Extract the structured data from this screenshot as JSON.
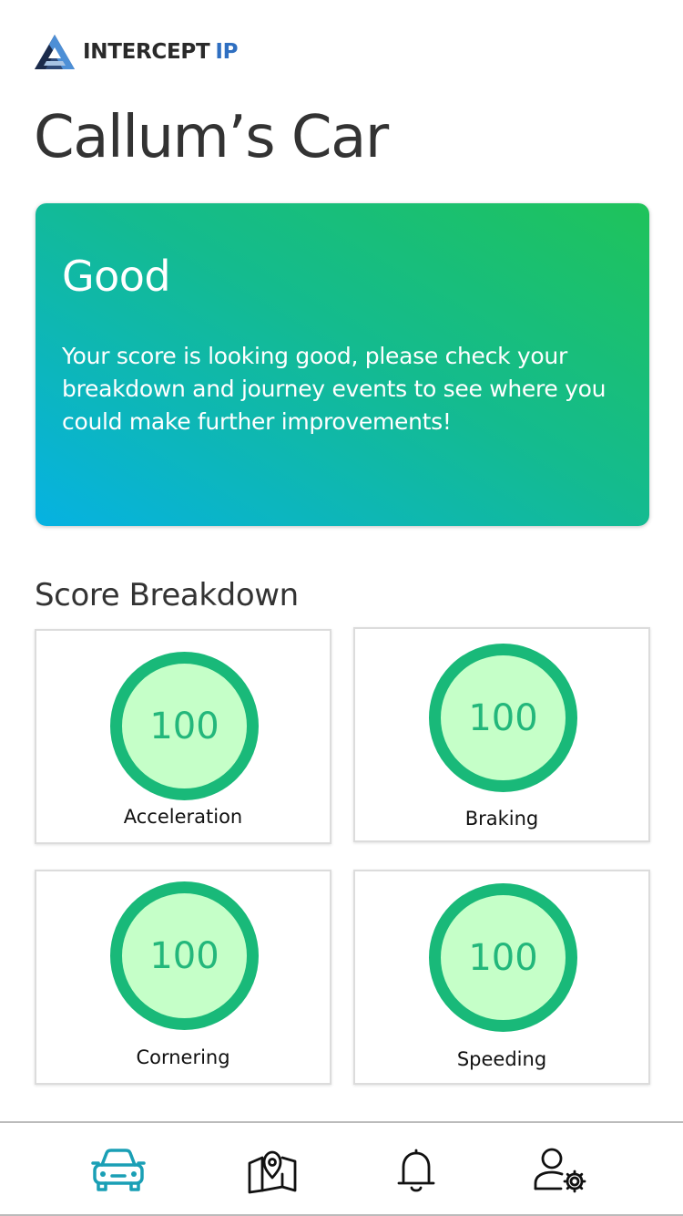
{
  "app": {
    "logo_word": "INTERCEPT",
    "logo_suffix": "IP"
  },
  "page": {
    "title": "Callum’s Car"
  },
  "status": {
    "rating": "Good",
    "message": "Your score is looking good, please check your breakdown and journey events to see where you could make further improvements!",
    "gradient_start": "#06b2e2",
    "gradient_end": "#1fc35a"
  },
  "breakdown": {
    "title": "Score Breakdown",
    "scores": [
      {
        "label": "Acceleration",
        "value": "100"
      },
      {
        "label": "Braking",
        "value": "100"
      },
      {
        "label": "Cornering",
        "value": "100"
      },
      {
        "label": "Speeding",
        "value": "100"
      }
    ],
    "ring_color": "#19b979",
    "ring_fill": "#c5ffc8"
  },
  "nav": {
    "items": [
      {
        "icon": "car-icon",
        "active": true
      },
      {
        "icon": "map-pin-icon",
        "active": false
      },
      {
        "icon": "bell-icon",
        "active": false
      },
      {
        "icon": "user-settings-icon",
        "active": false
      }
    ],
    "active_color": "#1a9fb5"
  }
}
